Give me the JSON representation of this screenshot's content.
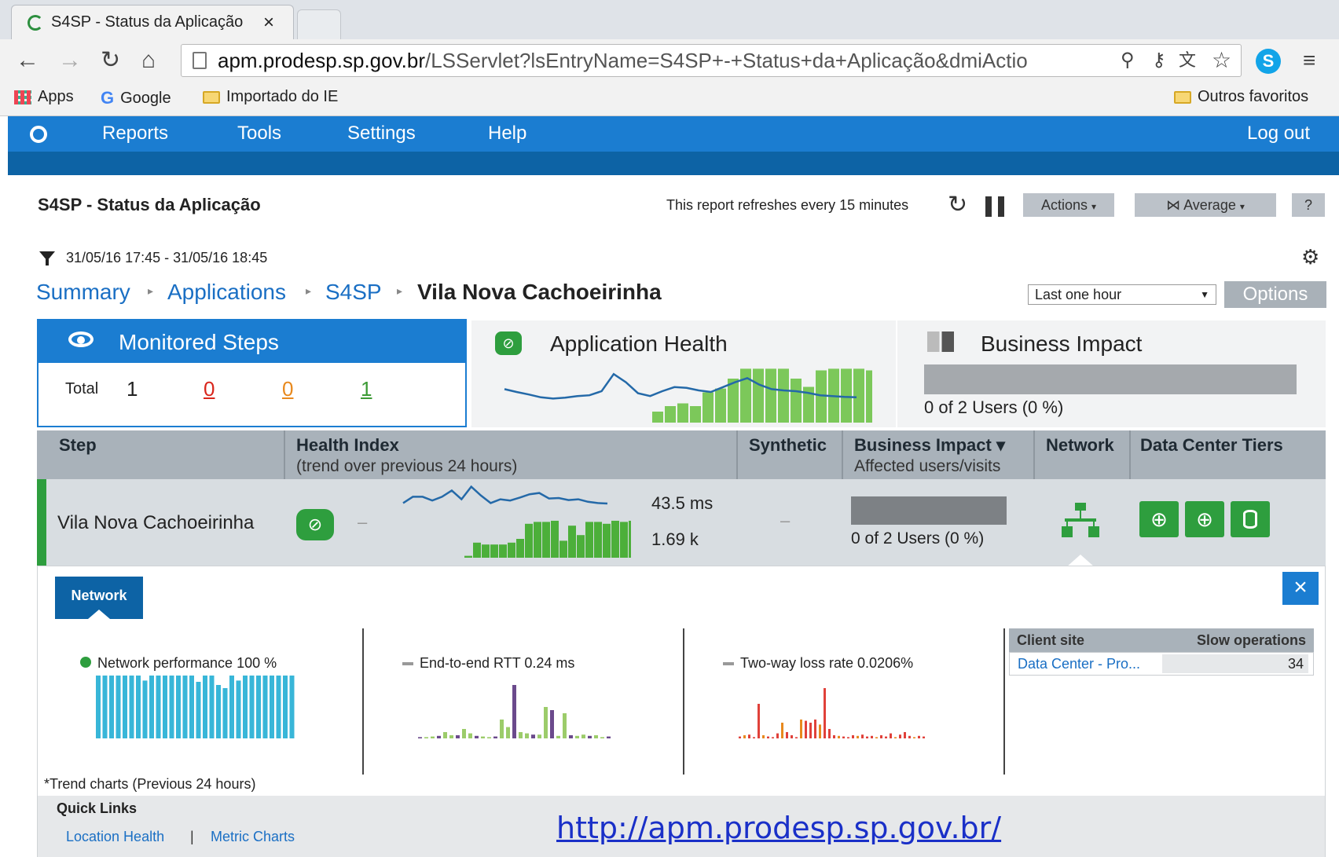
{
  "browser": {
    "tab_title": "S4SP - Status da Aplicação",
    "tab_close": "×",
    "url_host": "apm.prodesp.sp.gov.br",
    "url_path": "/LSServlet?lsEntryName=S4SP+-+Status+da+Aplicação&dmiActio",
    "bookmarks": [
      "Apps",
      "Google",
      "Importado do IE"
    ],
    "other_bookmarks": "Outros favoritos"
  },
  "app_nav": {
    "items": [
      "Reports",
      "Tools",
      "Settings",
      "Help"
    ],
    "logout": "Log out"
  },
  "report": {
    "title": "S4SP - Status da Aplicação",
    "refresh_text": "This report refreshes every 15 minutes",
    "actions_label": "Actions",
    "average_label": "Average",
    "help_label": "?",
    "date_range": "31/05/16 17:45 - 31/05/16 18:45",
    "timeframe": "Last one hour",
    "options_label": "Options"
  },
  "breadcrumb": {
    "items": [
      "Summary",
      "Applications",
      "S4SP"
    ],
    "current": "Vila Nova Cachoeirinha"
  },
  "monitored_steps": {
    "title": "Monitored Steps",
    "total_label": "Total",
    "total": "1",
    "red": "0",
    "orange": "0",
    "green": "1"
  },
  "app_health": {
    "title": "Application Health",
    "trend": [
      0.55,
      0.48,
      0.42,
      0.35,
      0.32,
      0.34,
      0.38,
      0.4,
      0.5,
      0.92,
      0.72,
      0.45,
      0.38,
      0.5,
      0.6,
      0.58,
      0.52,
      0.48,
      0.6,
      0.72,
      0.82,
      0.66,
      0.55,
      0.52,
      0.5,
      0.46,
      0.4,
      0.38,
      0.36,
      0.35
    ],
    "bars": [
      0.2,
      0.3,
      0.35,
      0.3,
      0.55,
      0.62,
      0.8,
      0.98,
      0.98,
      0.98,
      0.98,
      0.8,
      0.65,
      0.95,
      0.98,
      0.98,
      0.98,
      0.95,
      0.98,
      0.98,
      0.92,
      0.9,
      0.78
    ]
  },
  "business_impact_panel": {
    "title": "Business Impact",
    "value_text": "0 of 2 Users (0 %)"
  },
  "table": {
    "headers": {
      "step": "Step",
      "health": "Health Index",
      "health_sub": "(trend over previous 24 hours)",
      "synthetic": "Synthetic",
      "business": "Business Impact ▾",
      "business_sub": "Affected users/visits",
      "network": "Network",
      "tiers": "Data Center Tiers"
    },
    "row": {
      "step": "Vila Nova Cachoeirinha",
      "health_dash": "–",
      "synthetic_dash": "–",
      "response_time": "43.5 ms",
      "volume": "1.69 k",
      "business_value": "0 of 2 Users (0 %)",
      "trend": [
        0.3,
        0.55,
        0.55,
        0.4,
        0.55,
        0.8,
        0.45,
        0.95,
        0.6,
        0.3,
        0.45,
        0.4,
        0.52,
        0.65,
        0.7,
        0.48,
        0.5,
        0.42,
        0.45,
        0.35,
        0.3,
        0.28
      ],
      "bars": [
        0.05,
        0.4,
        0.35,
        0.35,
        0.35,
        0.4,
        0.5,
        0.9,
        0.95,
        0.95,
        0.98,
        0.45,
        0.85,
        0.6,
        0.95,
        0.95,
        0.9,
        0.98,
        0.95,
        0.98,
        0.92,
        0.75
      ]
    }
  },
  "network_detail": {
    "tab_label": "Network",
    "close": "×",
    "perf_label": "Network performance 100 %",
    "rtt_label": "End-to-end RTT 0.24 ms",
    "loss_label": "Two-way loss rate 0.0206%",
    "perf_bars": [
      1,
      1,
      1,
      1,
      1,
      1,
      1,
      0.92,
      1,
      1,
      1,
      1,
      1,
      1,
      1,
      0.9,
      1,
      1,
      0.85,
      0.8,
      1,
      0.92,
      1,
      1,
      1,
      1,
      1,
      1,
      1,
      1
    ],
    "rtt_bars": [
      0.02,
      0.02,
      0.03,
      0.04,
      0.1,
      0.05,
      0.05,
      0.15,
      0.08,
      0.04,
      0.03,
      0.02,
      0.03,
      0.3,
      0.18,
      0.85,
      0.1,
      0.08,
      0.06,
      0.06,
      0.5,
      0.45,
      0.04,
      0.4,
      0.05,
      0.04,
      0.06,
      0.04,
      0.05,
      0.02,
      0.03
    ],
    "loss_bars": [
      0.03,
      0.05,
      0.06,
      0.02,
      0.55,
      0.05,
      0.03,
      0.02,
      0.08,
      0.25,
      0.1,
      0.05,
      0.02,
      0.3,
      0.28,
      0.25,
      0.3,
      0.22,
      0.8,
      0.15,
      0.05,
      0.04,
      0.03,
      0.02,
      0.05,
      0.04,
      0.06,
      0.03,
      0.04,
      0.02,
      0.05,
      0.03,
      0.08,
      0.02,
      0.06,
      0.1,
      0.04,
      0.02,
      0.04,
      0.03
    ],
    "client_site_header": "Client site",
    "slow_ops_header": "Slow operations",
    "client_site": "Data Center - Pro...",
    "slow_ops": "34",
    "footnote": "*Trend charts (Previous 24 hours)",
    "quick_links_title": "Quick Links",
    "quick_links": [
      "Location Health",
      "Metric Charts"
    ],
    "quick_sep": "|"
  },
  "overlay_url": "http://apm.prodesp.sp.gov.br/",
  "colors": {
    "nav_blue": "#1b7dd1",
    "dark_blue": "#0d63a5",
    "green": "#2e9e3e",
    "bar_green": "#7cc85a",
    "cyan": "#38b6d8",
    "red_link": "#d9261c",
    "orange_link": "#e8891e",
    "green_link": "#3c9a35"
  },
  "icons": [
    "chrome-reload-icon",
    "back-icon",
    "forward-icon",
    "reload-icon",
    "home-icon",
    "page-icon",
    "zoom-icon",
    "key-icon",
    "translate-icon",
    "star-icon",
    "skype-icon",
    "menu-icon",
    "apps-icon",
    "google-icon",
    "folder-icon",
    "logo-icon",
    "filter-icon",
    "gear-icon",
    "refresh-icon",
    "pause-icon",
    "eye-icon",
    "health-icon",
    "users-icon",
    "network-icon",
    "globe-icon",
    "database-icon",
    "close-icon"
  ]
}
